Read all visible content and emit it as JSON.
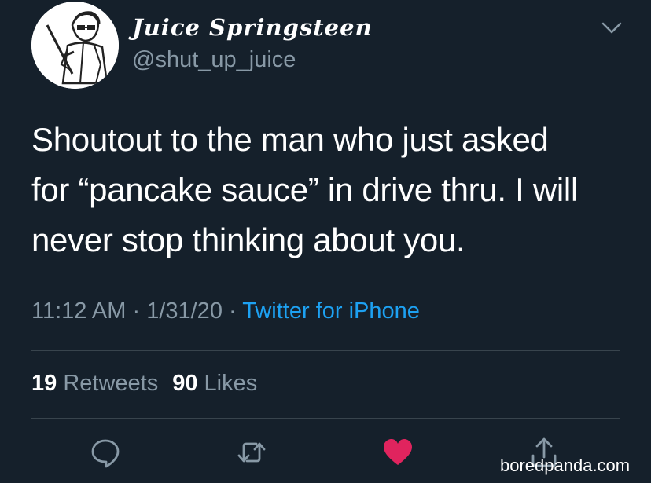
{
  "tweet": {
    "author": {
      "display_name": "Juice Springsteen",
      "handle": "@shut_up_juice"
    },
    "text_lines": [
      "Shoutout to the man who just asked",
      "for “pancake sauce” in drive thru. I will",
      "never stop thinking about you."
    ],
    "time": "11:12 AM",
    "date": "1/31/20",
    "separator": "·",
    "source": "Twitter for iPhone",
    "stats": {
      "retweets_count": "19",
      "retweets_label": "Retweets",
      "likes_count": "90",
      "likes_label": "Likes"
    },
    "liked": true
  },
  "icons": {
    "more": "chevron-down-icon",
    "reply": "reply-icon",
    "retweet": "retweet-icon",
    "like": "heart-icon",
    "share": "share-icon"
  },
  "colors": {
    "background": "#15202b",
    "secondary_text": "#8899a6",
    "link": "#1da1f2",
    "like": "#e0245e",
    "divider": "#38444d"
  },
  "watermark": "boredpanda.com"
}
